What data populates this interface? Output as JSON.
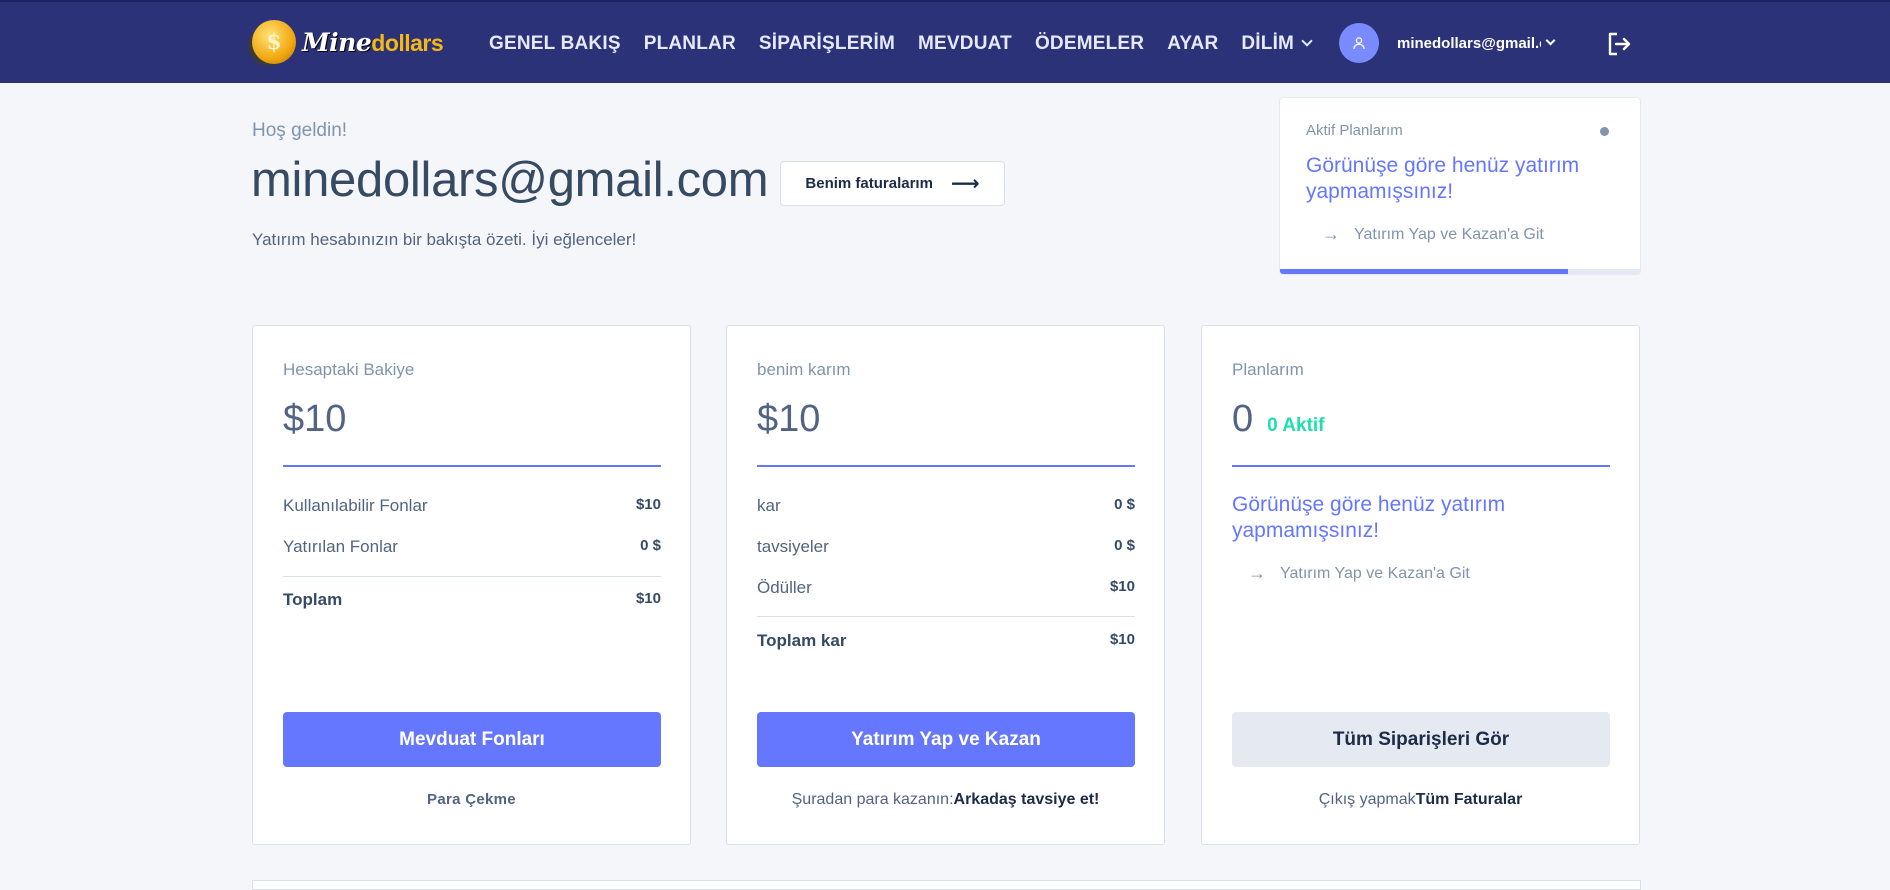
{
  "header": {
    "logo": {
      "part1": "Mine",
      "part2": "dollars",
      "coin_symbol": "$"
    },
    "nav": [
      {
        "label": "GENEL BAKIŞ"
      },
      {
        "label": "PLANLAR"
      },
      {
        "label": "SİPARİŞLERİM"
      },
      {
        "label": "MEVDUAT"
      },
      {
        "label": "ÖDEMELER"
      },
      {
        "label": "AYAR"
      },
      {
        "label": "DİLİM"
      }
    ],
    "user_email": "minedollars@gmail.c",
    "icons": {
      "user": "user-icon",
      "language_dropdown": "chevron-down-icon",
      "logout": "logout-icon"
    }
  },
  "welcome": {
    "greeting": "Hoş geldin!",
    "email": "minedollars@gmail.com",
    "invoices_button": "Benim faturalarım",
    "subtitle": "Yatırım hesabınızın bir bakışta özeti. İyi eğlenceler!"
  },
  "active_plans": {
    "title": "Aktif Planlarım",
    "message": "Görünüşe göre henüz yatırım yapmamışsınız!",
    "link": "Yatırım Yap ve Kazan'a Git",
    "progress_fraction": 0.8
  },
  "balance_card": {
    "title": "Hesaptaki Bakiye",
    "amount": "$10",
    "rows": [
      {
        "label": "Kullanılabilir Fonlar",
        "value": "$10"
      },
      {
        "label": "Yatırılan Fonlar",
        "value": "0 $"
      }
    ],
    "total": {
      "label": "Toplam",
      "value": "$10"
    },
    "button": "Mevduat Fonları",
    "footer_link": "Para Çekme"
  },
  "profit_card": {
    "title": "benim karım",
    "amount": "$10",
    "rows": [
      {
        "label": "kar",
        "value": "0 $"
      },
      {
        "label": "tavsiyeler",
        "value": "0 $"
      },
      {
        "label": "Ödüller",
        "value": "$10"
      }
    ],
    "total": {
      "label": "Toplam kar",
      "value": "$10"
    },
    "button": "Yatırım Yap ve Kazan",
    "footer_text": "Şuradan para kazanın:",
    "footer_link": "Arkadaş tavsiye et!"
  },
  "plans_card": {
    "title": "Planlarım",
    "count": "0",
    "badge": "0 Aktif",
    "message": "Görünüşe göre henüz yatırım yapmamışsınız!",
    "link": "Yatırım Yap ve Kazan'a Git",
    "button": "Tüm Siparişleri Gör",
    "footer_text": "Çıkış yapmak",
    "footer_link": "Tüm Faturalar"
  },
  "colors": {
    "header_bg": "#2b3278",
    "accent": "#6576ff",
    "success": "#1ee0ac",
    "text_muted": "#8094ae"
  }
}
